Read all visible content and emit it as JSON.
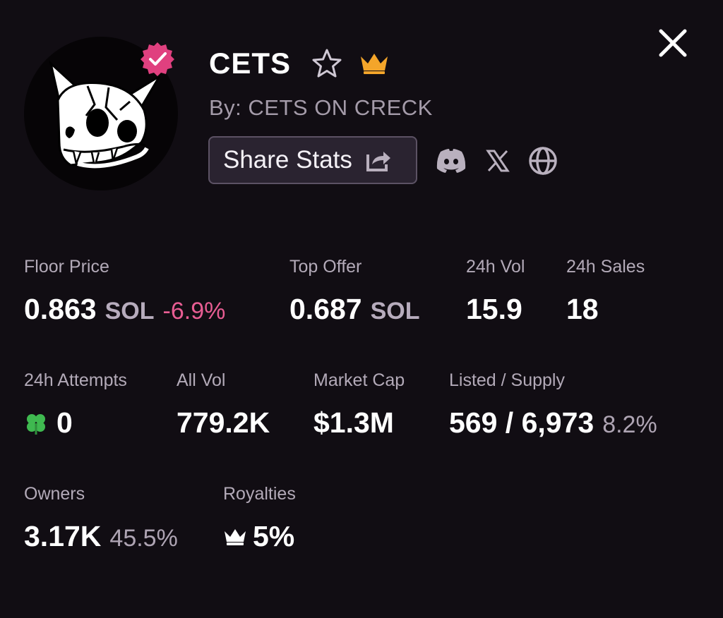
{
  "collection": {
    "name": "CETS",
    "creator": "By: CETS ON CRECK",
    "share_label": "Share Stats"
  },
  "icons": {
    "verified": "verified-check-icon",
    "favorite": "star-outline-icon",
    "premium": "crown-icon",
    "share": "share-arrow-icon",
    "discord": "discord-icon",
    "x": "x-logo-icon",
    "website": "globe-icon",
    "close": "close-icon",
    "attempts": "four-leaf-clover-icon",
    "royalties": "crown-icon"
  },
  "colors": {
    "background": "#110d13",
    "accent_negative": "#e85d93",
    "crown": "#f4a52a",
    "verified": "#e0407f"
  },
  "stats": {
    "floor_price": {
      "label": "Floor Price",
      "value": "0.863",
      "unit": "SOL",
      "change": "-6.9%"
    },
    "top_offer": {
      "label": "Top Offer",
      "value": "0.687",
      "unit": "SOL"
    },
    "vol_24h": {
      "label": "24h Vol",
      "value": "15.9"
    },
    "sales_24h": {
      "label": "24h Sales",
      "value": "18"
    },
    "attempts_24h": {
      "label": "24h Attempts",
      "value": "0"
    },
    "all_vol": {
      "label": "All Vol",
      "value": "779.2K"
    },
    "market_cap": {
      "label": "Market Cap",
      "value": "$1.3M"
    },
    "listed_supply": {
      "label": "Listed / Supply",
      "value": "569 / 6,973",
      "percent": "8.2%"
    },
    "owners": {
      "label": "Owners",
      "value": "3.17K",
      "percent": "45.5%"
    },
    "royalties": {
      "label": "Royalties",
      "value": "5%"
    }
  }
}
